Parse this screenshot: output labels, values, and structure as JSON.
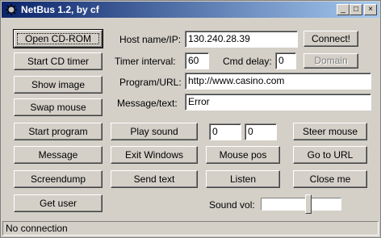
{
  "window": {
    "title": "NetBus 1.2, by cf",
    "minimize": "_",
    "maximize": "□",
    "close": "×"
  },
  "buttons": {
    "open_cdrom": "Open CD-ROM",
    "start_cd_timer": "Start CD timer",
    "show_image": "Show image",
    "swap_mouse": "Swap mouse",
    "start_program": "Start program",
    "message": "Message",
    "screendump": "Screendump",
    "get_user": "Get user",
    "play_sound": "Play sound",
    "exit_windows": "Exit Windows",
    "send_text": "Send text",
    "mouse_pos": "Mouse pos",
    "listen": "Listen",
    "steer_mouse": "Steer mouse",
    "go_to_url": "Go to URL",
    "close_me": "Close me",
    "connect": "Connect!",
    "domain": "Domain"
  },
  "labels": {
    "host": "Host name/IP:",
    "timer_interval": "Timer interval:",
    "cmd_delay": "Cmd delay:",
    "program_url": "Program/URL:",
    "message_text": "Message/text:",
    "sound_vol": "Sound vol:"
  },
  "fields": {
    "host": "130.240.28.39",
    "timer_interval": "60",
    "cmd_delay": "0",
    "program_url": "http://www.casino.com",
    "message_text": "Error",
    "play_a": "0",
    "play_b": "0"
  },
  "sound_volume": {
    "position": 0.6
  },
  "status": "No connection"
}
